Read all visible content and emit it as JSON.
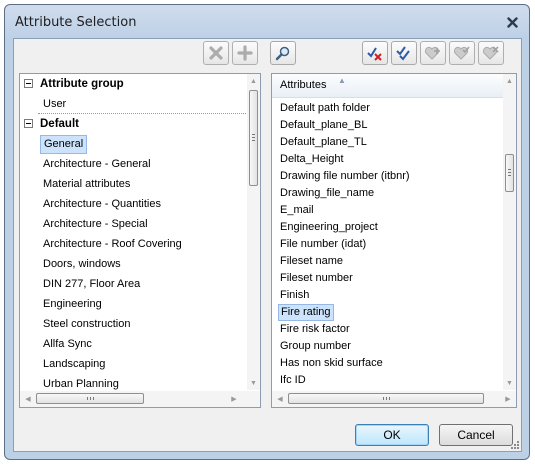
{
  "window": {
    "title": "Attribute Selection"
  },
  "toolbar": {
    "icons": [
      "delete-x-icon",
      "add-plus-icon",
      "search-magnifier-icon",
      "uncheck-all-icon",
      "check-all-icon",
      "heart-add-icon",
      "heart-check-icon",
      "heart-remove-icon"
    ]
  },
  "tree": {
    "groups": [
      {
        "label": "Attribute group",
        "children": [
          "User"
        ]
      },
      {
        "label": "Default",
        "children": [
          "General",
          "Architecture - General",
          "Material attributes",
          "Architecture - Quantities",
          "Architecture - Special",
          "Architecture -  Roof Covering",
          "Doors, windows",
          "DIN 277, Floor Area",
          "Engineering",
          "Steel construction",
          "Allfa Sync",
          "Landscaping",
          "Urban Planning"
        ]
      }
    ],
    "selected": "General"
  },
  "attributes": {
    "header": "Attributes",
    "items": [
      "Default path folder",
      "Default_plane_BL",
      "Default_plane_TL",
      "Delta_Height",
      "Drawing file number (itbnr)",
      "Drawing_file_name",
      "E_mail",
      "Engineering_project",
      "File number (idat)",
      "Fileset name",
      "Fileset number",
      "Finish",
      "Fire rating",
      "Fire risk factor",
      "Group number",
      "Has non skid surface",
      "Ifc ID"
    ],
    "selected": "Fire rating"
  },
  "buttons": {
    "ok": "OK",
    "cancel": "Cancel"
  },
  "colors": {
    "selection": "#cde3fb",
    "selection_border": "#95b8e7",
    "titlebar": "#c2d3e8"
  }
}
